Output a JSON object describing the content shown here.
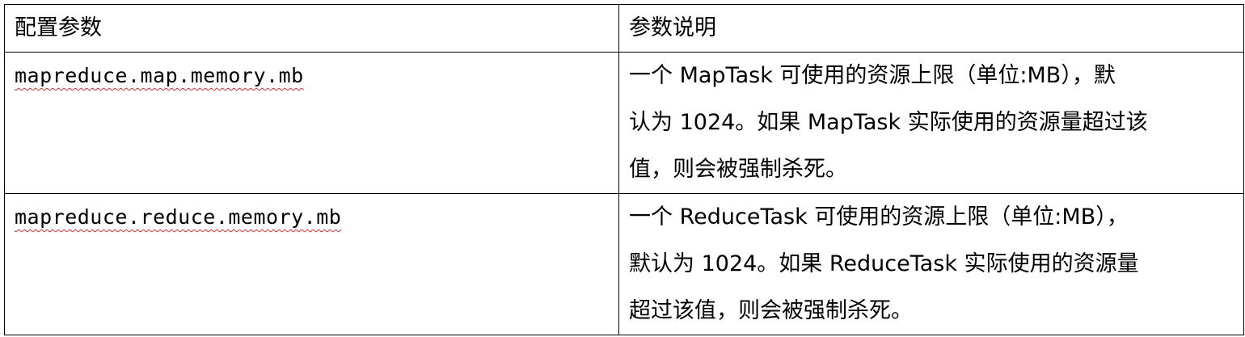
{
  "table": {
    "headers": {
      "param": "配置参数",
      "desc": "参数说明"
    },
    "rows": [
      {
        "param": "mapreduce.map.memory.mb",
        "desc_lines": [
          "一个 MapTask 可使用的资源上限（单位:MB），默",
          "认为 1024。如果 MapTask 实际使用的资源量超过该",
          "值，则会被强制杀死。"
        ]
      },
      {
        "param": "mapreduce.reduce.memory.mb",
        "desc_lines": [
          "一个 ReduceTask 可使用的资源上限（单位:MB），",
          "默认为 1024。如果 ReduceTask 实际使用的资源量",
          "超过该值，则会被强制杀死。"
        ]
      }
    ]
  }
}
